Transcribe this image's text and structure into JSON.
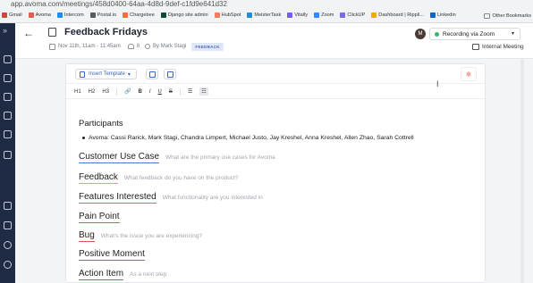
{
  "browser": {
    "url": "app.avoma.com/meetings/458d0400-64aa-4d8d-9def-c1fd9e641d32",
    "bookmarks": [
      {
        "label": "Gmail",
        "color": "#d44638"
      },
      {
        "label": "Avoma",
        "color": "#e55d4a"
      },
      {
        "label": "Intercom",
        "color": "#1f8ded"
      },
      {
        "label": "Postal.io",
        "color": "#5a5a5a"
      },
      {
        "label": "Chargebee",
        "color": "#ff6c37"
      },
      {
        "label": "Django site admin",
        "color": "#0c4b33"
      },
      {
        "label": "HubSpot",
        "color": "#ff7a59"
      },
      {
        "label": "MeisterTask",
        "color": "#1e8fd6"
      },
      {
        "label": "Vitally",
        "color": "#7a5af5"
      },
      {
        "label": "Zoom",
        "color": "#2d8cff"
      },
      {
        "label": "ClickUP",
        "color": "#7b68ee"
      },
      {
        "label": "Dashboard | Rippli...",
        "color": "#f2a900"
      },
      {
        "label": "Linkedin",
        "color": "#0a66c2"
      }
    ],
    "other_bookmarks": "Other Bookmarks"
  },
  "meeting": {
    "title": "Feedback Fridays",
    "datetime": "Nov 11th, 11am - 11:45am",
    "attendee_count": "8",
    "organizer": "By Mark Stagi",
    "tag": "FEEDBACK",
    "avatar_initial": "M",
    "recording_label": "Recording via Zoom",
    "meeting_type": "Internal Meeting"
  },
  "editor": {
    "insert_template": "Insert Template",
    "format_buttons": [
      "H1",
      "H2",
      "H3",
      "🔗",
      "B",
      "I",
      "U",
      "S",
      "☰",
      "☷"
    ],
    "participants_heading": "Participants",
    "participants_line": "Avoma: Cassi Rarick, Mark Stagi, Chandra Limpert, Michael Justo, Jay Kreshel, Anna Kreshel, Allen Zhao, Sarah Cottrell",
    "sections": [
      {
        "heading": "Customer Use Case",
        "prompt": "What are the primary use cases for Avoma",
        "color": "#4a78d4"
      },
      {
        "heading": "Feedback",
        "prompt": "What feedback do you have on the product?",
        "color": "#f2a93b"
      },
      {
        "heading": "Features Interested",
        "prompt": "What functionality are you interested in",
        "color": "#4caf50"
      },
      {
        "heading": "Pain Point",
        "prompt": "",
        "color": "#e05555"
      },
      {
        "heading": "Bug",
        "prompt": "What's the issue you are experiencing?",
        "color": "#e05555"
      },
      {
        "heading": "Positive Moment",
        "prompt": "",
        "color": "#8a5cd6"
      },
      {
        "heading": "Action Item",
        "prompt": "As a next step",
        "color": "#4a78d4"
      }
    ]
  }
}
